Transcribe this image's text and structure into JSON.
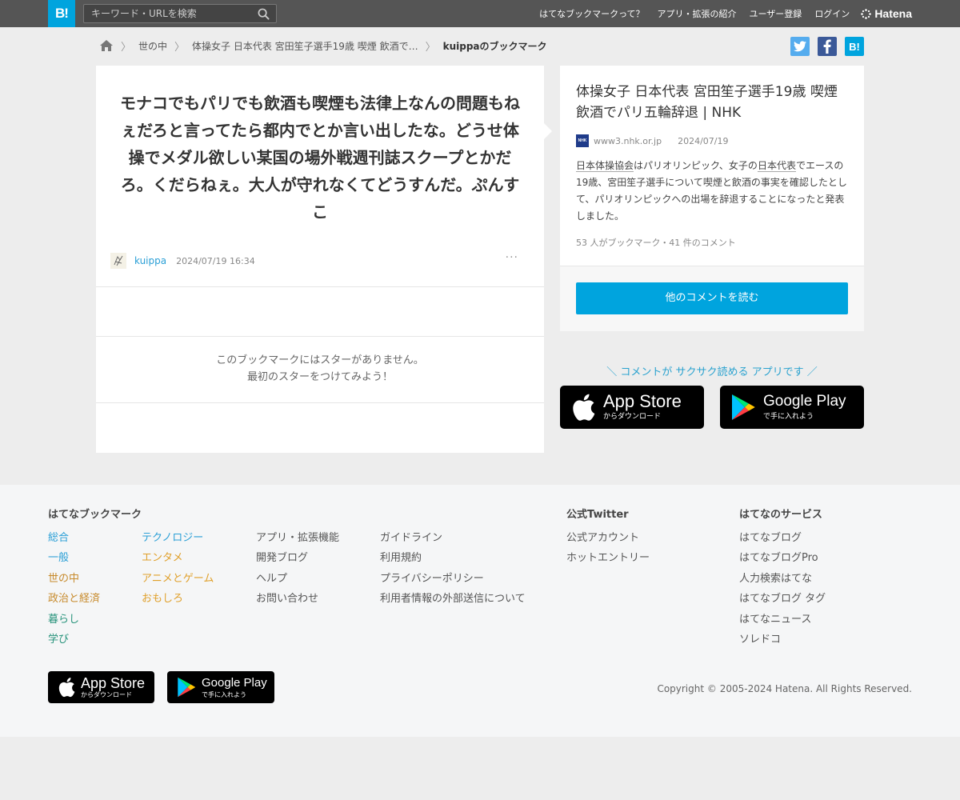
{
  "colors": {
    "accent": "#00a4de",
    "topbar": "#555555",
    "twitter": "#55acee",
    "facebook": "#3b5998"
  },
  "header": {
    "logo": "B!",
    "search_placeholder": "キーワード・URLを検索",
    "nav": [
      "はてなブックマークって？",
      "アプリ・拡張の紹介",
      "ユーザー登録",
      "ログイン"
    ],
    "brand": "Hatena"
  },
  "breadcrumb": {
    "items": [
      "世の中",
      "体操女子 日本代表 宮田笙子選手19歳 喫煙 飲酒で…"
    ],
    "current": "kuippaのブックマーク"
  },
  "share": {
    "hatena": "B!"
  },
  "comment": {
    "text": "モナコでもパリでも飲酒も喫煙も法律上なんの問題もねぇだろと言ってたら都内でとか言い出したな。どうせ体操でメダル欲しい某国の場外戦週刊誌スクープとかだろ。くだらねぇ。大人が守れなくてどうすんだ。ぷんすこ",
    "user": "kuippa",
    "date": "2024/07/19 16:34",
    "more": "···",
    "no_star_line1": "このブックマークにはスターがありません。",
    "no_star_line2": "最初のスターをつけてみよう！"
  },
  "entry": {
    "title": "体操女子 日本代表 宮田笙子選手19歳 喫煙 飲酒でパリ五輪辞退 | NHK",
    "favicon": "NHK",
    "domain": "www3.nhk.or.jp",
    "date": "2024/07/19",
    "desc_1": "",
    "desc_em1": "日本体操協会",
    "desc_2": "はパリオリンピック、女子の",
    "desc_em2": "日本代表",
    "desc_3": "でエースの19歳、宮田笙子選手について喫煙と飲酒の事実を確認したとして、パリオリンピックへの出場を辞退することになったと発表しました。",
    "stats": "53 人がブックマーク・41 件のコメント",
    "read_button": "他のコメントを読む"
  },
  "promo": {
    "text": "＼ コメントが サクサク読める アプリです ／",
    "appstore_name": "App Store",
    "appstore_sub": "からダウンロード",
    "googleplay_name": "Google Play",
    "googleplay_sub": "で手に入れよう"
  },
  "footer": {
    "bookmark_head": "はてなブックマーク",
    "categories_col1": [
      "総合",
      "一般",
      "世の中",
      "政治と経済",
      "暮らし",
      "学び"
    ],
    "categories_col2": [
      "テクノロジー",
      "エンタメ",
      "アニメとゲーム",
      "おもしろ"
    ],
    "links_col3": [
      "アプリ・拡張機能",
      "開発ブログ",
      "ヘルプ",
      "お問い合わせ"
    ],
    "links_col4": [
      "ガイドライン",
      "利用規約",
      "プライバシーポリシー",
      "利用者情報の外部送信について"
    ],
    "twitter_head": "公式Twitter",
    "twitter_links": [
      "公式アカウント",
      "ホットエントリー"
    ],
    "services_head": "はてなのサービス",
    "services": [
      "はてなブログ",
      "はてなブログPro",
      "人力検索はてな",
      "はてなブログ タグ",
      "はてなニュース",
      "ソレドコ"
    ],
    "copyright": "Copyright © 2005-2024 Hatena. All Rights Reserved."
  }
}
